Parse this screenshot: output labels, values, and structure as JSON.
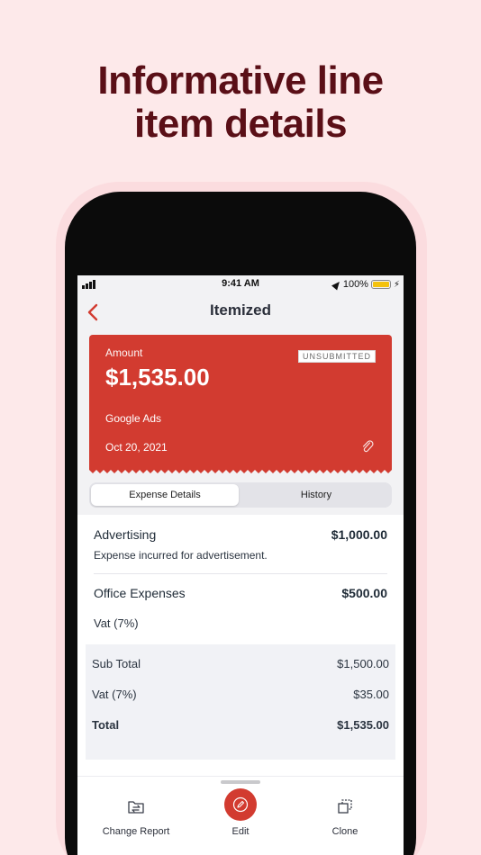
{
  "headline": {
    "line1": "Informative line",
    "line2": "item details"
  },
  "status_bar": {
    "time": "9:41 AM",
    "battery_percent": "100%"
  },
  "nav": {
    "title": "Itemized"
  },
  "expense_card": {
    "amount_label": "Amount",
    "amount": "$1,535.00",
    "status": "UNSUBMITTED",
    "merchant": "Google Ads",
    "date": "Oct 20, 2021",
    "color": "#d23b30"
  },
  "tabs": [
    {
      "label": "Expense Details",
      "selected": true
    },
    {
      "label": "History",
      "selected": false
    }
  ],
  "line_items": [
    {
      "name": "Advertising",
      "amount": "$1,000.00",
      "description": "Expense incurred for advertisement."
    },
    {
      "name": "Office Expenses",
      "amount": "$500.00",
      "description": "Vat (7%)"
    }
  ],
  "summary": {
    "subtotal_label": "Sub Total",
    "subtotal": "$1,500.00",
    "tax_label": "Vat (7%)",
    "tax": "$35.00",
    "total_label": "Total",
    "total": "$1,535.00"
  },
  "bottom_actions": [
    {
      "label": "Change Report",
      "icon": "folder-swap-icon"
    },
    {
      "label": "Edit",
      "icon": "pencil-icon"
    },
    {
      "label": "Clone",
      "icon": "clone-icon"
    }
  ]
}
